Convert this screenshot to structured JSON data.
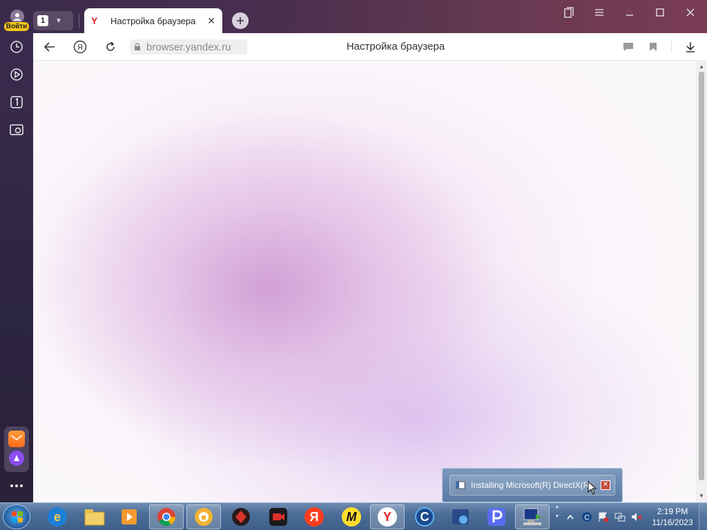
{
  "profile": {
    "login_label": "Войти"
  },
  "tabs": {
    "count": "1",
    "active_title": "Настройка браузера"
  },
  "addressbar": {
    "url": "browser.yandex.ru",
    "page_title": "Настройка браузера"
  },
  "popup": {
    "label": "Installing Microsoft(R) DirectX(R)"
  },
  "taskbar": {
    "time": "2:19 PM",
    "date": "11/16/2023",
    "apps": [
      "ie-icon",
      "explorer-icon",
      "media-icon",
      "chrome-icon",
      "vpn-icon",
      "game-icon",
      "recorder-icon",
      "yandex-icon",
      "market-icon",
      "yandex-browser-icon",
      "ccleaner-icon",
      "screenshot-icon",
      "p-app-icon",
      "installer-icon"
    ]
  },
  "colors": {
    "accent_yellow": "#f5c518",
    "taskbar": "#4b6d98",
    "yandex_red": "#e02020"
  }
}
